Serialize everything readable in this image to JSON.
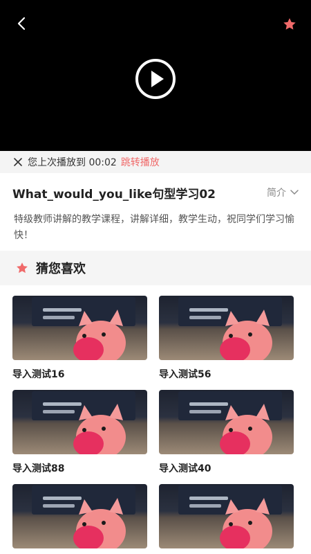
{
  "resume_bar": {
    "text": "您上次播放到 00:02",
    "jump_label": "跳转播放"
  },
  "course": {
    "title": "What_would_you_like句型学习02",
    "intro_label": "简介",
    "description": "特级教师讲解的教学课程，讲解详细，教学生动，祝同学们学习愉快！"
  },
  "recommend": {
    "header": "猜您喜欢",
    "items": [
      {
        "title": "导入测试16"
      },
      {
        "title": "导入测试56"
      },
      {
        "title": "导入测试88"
      },
      {
        "title": "导入测试40"
      },
      {
        "title": ""
      },
      {
        "title": ""
      }
    ]
  },
  "colors": {
    "accent": "#f06a6a",
    "video_bg": "#000000",
    "section_bg": "#f5f5f5"
  },
  "icons": {
    "back": "chevron-left-icon",
    "favorite": "star-icon",
    "play": "play-circle-icon",
    "close": "close-icon",
    "expand": "chevron-down-icon"
  }
}
